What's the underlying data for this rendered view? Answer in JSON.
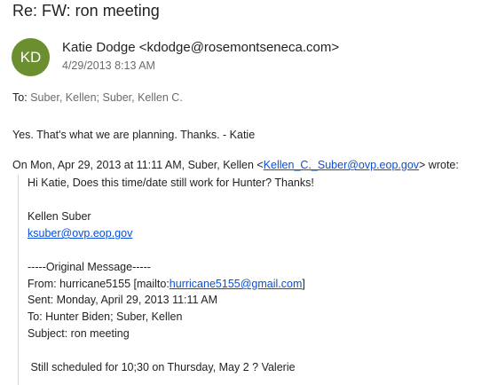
{
  "subject": "Re: FW: ron meeting",
  "sender": {
    "initials": "KD",
    "avatar_color": "#6b8e2f",
    "display": "Katie Dodge <kdodge@rosemontseneca.com>",
    "date": "4/29/2013 8:13 AM"
  },
  "to_line": {
    "prefix": "To:",
    "recipients": "Suber, Kellen; Suber, Kellen C."
  },
  "reply_text": "Yes.  That's what we are planning.  Thanks. - Katie",
  "quote_header": {
    "before": "On Mon, Apr 29, 2013 at 11:11 AM, Suber, Kellen <",
    "email": "Kellen_C._Suber@ovp.eop.gov",
    "after": "> wrote:"
  },
  "quoted": {
    "greeting": "Hi Katie, Does this time/date still work for Hunter? Thanks!",
    "signature_name": "Kellen Suber",
    "signature_email": "ksuber@ovp.eop.gov",
    "original_marker": "-----Original Message-----",
    "from_prefix": "From: hurricane5155 [mailto:",
    "from_email": "hurricane5155@gmail.com",
    "from_suffix": "]",
    "sent": "Sent: Monday, April 29, 2013 11:11 AM",
    "to": "To: Hunter Biden; Suber, Kellen",
    "subject": "Subject: ron meeting",
    "body": " Still scheduled for 10;30 on Thursday, May 2 ? Valerie"
  }
}
